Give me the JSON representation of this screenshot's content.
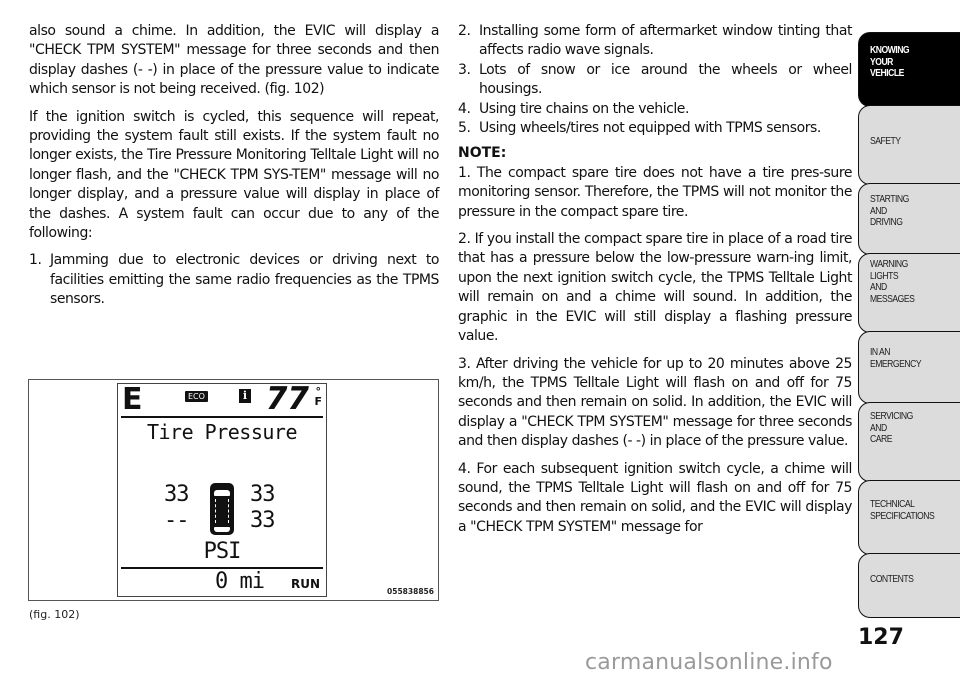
{
  "left_column": {
    "paragraphs": [
      "also sound a chime. In addition, the EVIC will display a \"CHECK TPM SYSTEM\" message for three seconds and then display dashes (- -) in place of the pressure value to indicate which sensor is not being received. (fig. 102)",
      "If the ignition switch is cycled, this sequence will repeat, providing the system fault still exists. If the system fault no longer exists, the Tire Pressure Monitoring Telltale Light will no longer flash, and the \"CHECK TPM SYS-TEM\" message will no longer display, and a pressure value will display in place of the dashes. A system fault can occur due to any of the following:"
    ],
    "list": [
      {
        "num": "1.",
        "text": "Jamming due to electronic devices or driving next to facilities emitting the same radio frequencies as the TPMS sensors."
      }
    ]
  },
  "right_column": {
    "list": [
      {
        "num": "2.",
        "text": "Installing some form of aftermarket window tinting that affects radio wave signals."
      },
      {
        "num": "3.",
        "text": "Lots of snow or ice around the wheels or wheel housings."
      },
      {
        "num": "4.",
        "text": "Using tire chains on the vehicle."
      },
      {
        "num": "5.",
        "text": "Using wheels/tires not equipped with TPMS sensors."
      }
    ],
    "note_title": "NOTE:",
    "notes": [
      "1.  The compact spare tire does not have a tire pres-sure monitoring sensor. Therefore, the TPMS will not monitor the pressure in the compact spare tire.",
      "2.  If you install the compact spare tire in place of a road tire that has a pressure below the low-pressure warn-ing limit, upon the next ignition switch cycle, the TPMS Telltale Light will remain on and a chime will sound. In addition, the graphic in the EVIC will still display a flashing pressure value.",
      "3.  After driving the vehicle for up to 20 minutes above 25 km/h, the TPMS Telltale Light will flash on and off for 75 seconds and then remain on solid. In addition, the EVIC will display a \"CHECK TPM SYSTEM\" message for three seconds and then display dashes (- -) in place of the pressure value.",
      "4.  For each subsequent ignition switch cycle, a chime will sound, the TPMS Telltale Light will flash on and off for 75 seconds and then remain on solid, and the EVIC will display a \"CHECK TPM SYSTEM\" message for"
    ]
  },
  "figure": {
    "screen": {
      "gear": "E",
      "eco_badge": "ECO",
      "info_badge": "i",
      "temperature": "77",
      "temp_unit_deg": "°",
      "temp_unit": "F",
      "title": "Tire Pressure",
      "front_left": "33",
      "front_right": "33",
      "rear_left": "--",
      "rear_right": "33",
      "pressure_unit": "PSI",
      "odometer": "0 mi",
      "mode": "RUN"
    },
    "code": "055838856",
    "caption": "(fig. 102)"
  },
  "sidebar": {
    "tabs": [
      {
        "label": "KNOWING\nYOUR\nVEHICLE",
        "active": true
      },
      {
        "label": "SAFETY",
        "active": false
      },
      {
        "label": "STARTING\nAND\nDRIVING",
        "active": false
      },
      {
        "label": "WARNING\nLIGHTS\nAND\nMESSAGES",
        "active": false
      },
      {
        "label": "IN AN\nEMERGENCY",
        "active": false
      },
      {
        "label": "SERVICING\nAND\nCARE",
        "active": false
      },
      {
        "label": "TECHNICAL\nSPECIFICATIONS",
        "active": false
      },
      {
        "label": "CONTENTS",
        "active": false
      }
    ]
  },
  "page_number": "127",
  "watermark": "carmanualsonline.info"
}
